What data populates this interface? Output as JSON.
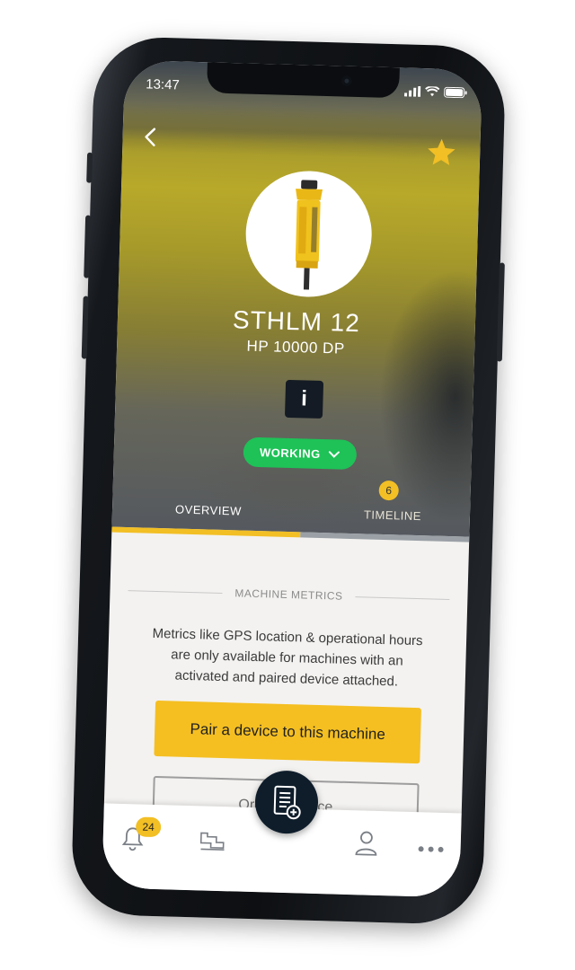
{
  "status_bar": {
    "time": "13:47"
  },
  "machine": {
    "name": "STHLM 12",
    "model": "HP 10000 DP",
    "info_label": "i",
    "status": "WORKING"
  },
  "tabs": [
    {
      "label": "OVERVIEW",
      "active": true
    },
    {
      "label": "TIMELINE",
      "badge": "6",
      "active": false
    }
  ],
  "metrics": {
    "heading": "MACHINE METRICS",
    "description": "Metrics like GPS location & operational hours are only available for machines with an activated and paired device attached.",
    "pair_button": "Pair a device to this machine",
    "order_button": "Order a device"
  },
  "bottom_nav": {
    "notifications_count": "24",
    "items": [
      "bell-icon",
      "machine-icon",
      "add-report-icon",
      "user-icon",
      "more-icon"
    ]
  },
  "colors": {
    "accent": "#f2bf24",
    "status_green": "#1ec257",
    "info_bg": "#141b24",
    "fab_bg": "#0f1d2b"
  }
}
